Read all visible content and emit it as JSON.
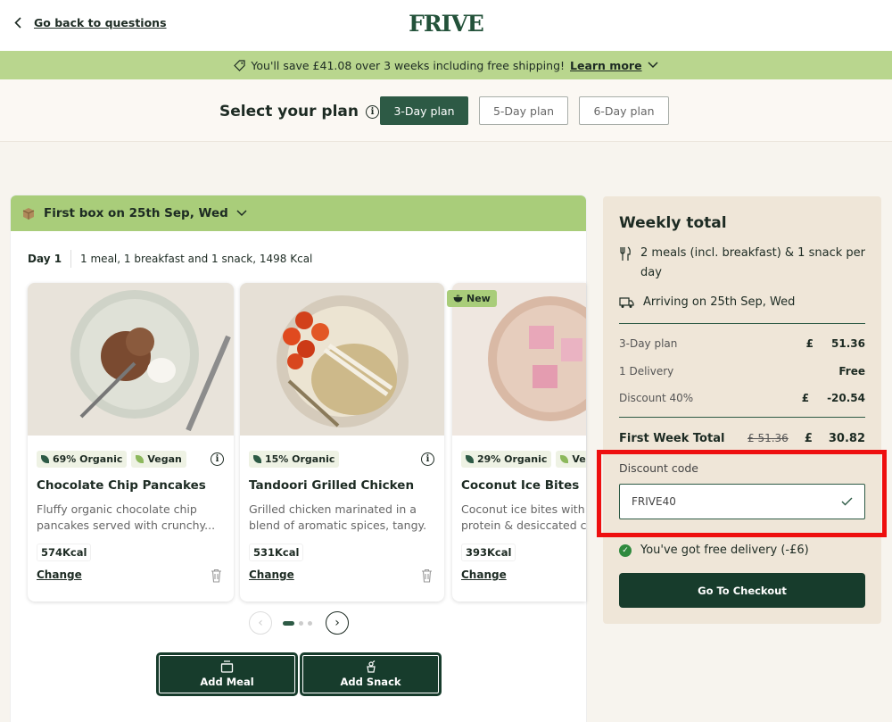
{
  "header": {
    "back_label": "Go back to questions",
    "logo": "FRIVE"
  },
  "promo": {
    "text": "You'll save £41.08 over 3 weeks including free shipping!",
    "link": "Learn more"
  },
  "plan": {
    "title": "Select your plan",
    "options": [
      "3-Day plan",
      "5-Day plan",
      "6-Day plan"
    ],
    "selected": "3-Day plan"
  },
  "box": {
    "title": "First box on 25th Sep, Wed"
  },
  "day": {
    "label": "Day 1",
    "summary": "1 meal, 1 breakfast and 1 snack, 1498 Kcal"
  },
  "cards": [
    {
      "tags": [
        "69% Organic",
        "Vegan"
      ],
      "title": "Chocolate Chip Pancakes",
      "desc1": "Fluffy organic chocolate chip",
      "desc2": "pancakes served with crunchy...",
      "kcal": "574Kcal",
      "change": "Change"
    },
    {
      "tags": [
        "15% Organic"
      ],
      "title": "Tandoori Grilled Chicken",
      "desc1": "Grilled chicken marinated in a",
      "desc2": "blend of aromatic spices, tangy...",
      "kcal": "531Kcal",
      "change": "Change"
    },
    {
      "tags": [
        "29% Organic",
        "Veg"
      ],
      "title": "Coconut Ice Bites",
      "desc1": "Coconut ice bites with fa",
      "desc2": "protein & desiccated co",
      "kcal": "393Kcal",
      "change": "Change",
      "badge": "New"
    }
  ],
  "actions": {
    "add_meal": "Add Meal",
    "add_snack": "Add Snack"
  },
  "summary": {
    "title": "Weekly total",
    "meals_text": "2 meals (incl. breakfast) & 1 snack per day",
    "arrival_text": "Arriving on 25th Sep, Wed",
    "lines": [
      {
        "label": "3-Day plan",
        "currency": "£",
        "value": "51.36"
      },
      {
        "label": "1 Delivery",
        "currency": "",
        "value": "Free"
      },
      {
        "label": "Discount 40%",
        "currency": "£",
        "value": "-20.54"
      }
    ],
    "first_week_label": "First Week Total",
    "first_week_old": "£ 51.36",
    "first_week_currency": "£",
    "first_week_value": "30.82",
    "discount_label": "Discount code",
    "discount_code": "FRIVE40",
    "free_delivery": "You've got free delivery (-£6)",
    "checkout": "Go To Checkout"
  }
}
